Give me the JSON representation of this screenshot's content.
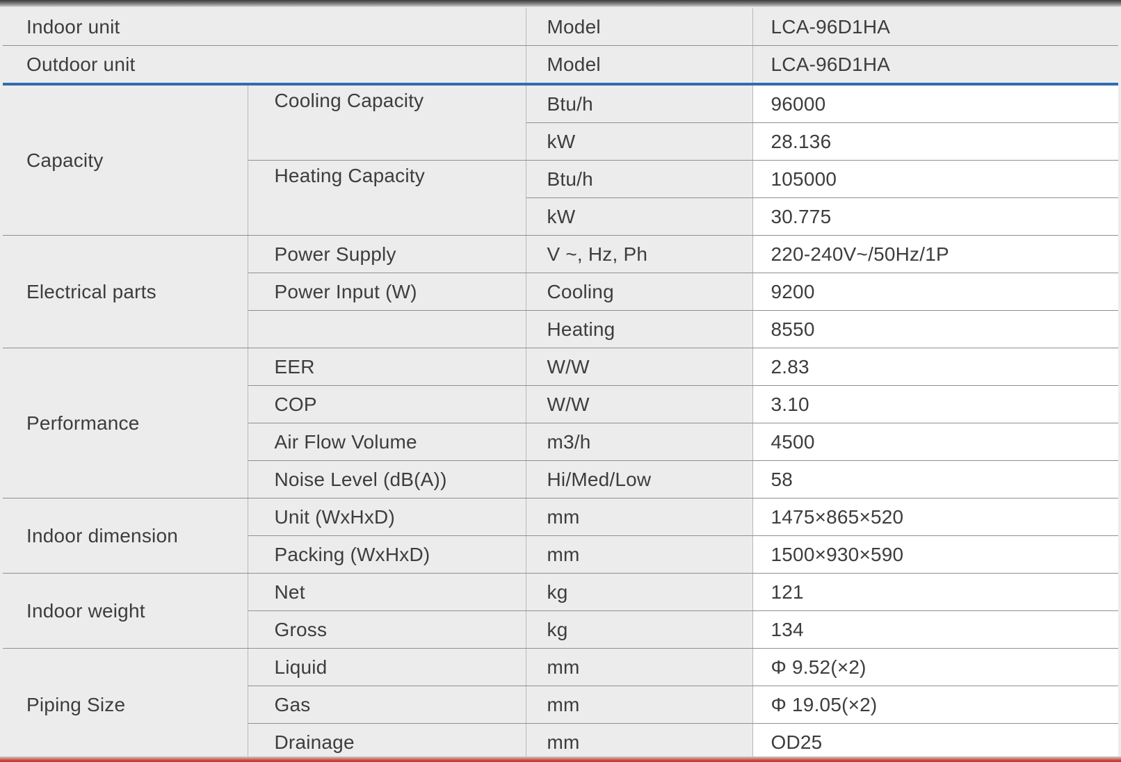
{
  "header": [
    {
      "label": "Indoor unit",
      "field": "Model",
      "value": "LCA-96D1HA"
    },
    {
      "label": "Outdoor unit",
      "field": "Model",
      "value": "LCA-96D1HA"
    }
  ],
  "sections": [
    {
      "name": "Capacity",
      "rows": [
        {
          "item": "Cooling Capacity",
          "unit": "Btu/h",
          "value": "96000"
        },
        {
          "item": "",
          "unit": "kW",
          "value": "28.136"
        },
        {
          "item": "Heating Capacity",
          "unit": "Btu/h",
          "value": "105000"
        },
        {
          "item": "",
          "unit": "kW",
          "value": "30.775"
        }
      ]
    },
    {
      "name": "Electrical   parts",
      "rows": [
        {
          "item": "Power Supply",
          "unit": "V ~, Hz, Ph",
          "value": "220-240V~/50Hz/1P"
        },
        {
          "item": "Power Input (W)",
          "unit": "Cooling",
          "value": "9200"
        },
        {
          "item": "",
          "unit": "Heating",
          "value": "8550"
        }
      ]
    },
    {
      "name": "Performance",
      "rows": [
        {
          "item": "EER",
          "unit": "W/W",
          "value": "2.83"
        },
        {
          "item": "COP",
          "unit": "W/W",
          "value": "3.10"
        },
        {
          "item": "Air Flow Volume",
          "unit": "m3/h",
          "value": "4500"
        },
        {
          "item": "Noise Level (dB(A))",
          "unit": "Hi/Med/Low",
          "value": "58"
        }
      ]
    },
    {
      "name": "Indoor dimension",
      "rows": [
        {
          "item": "Unit (WxHxD)",
          "unit": "mm",
          "value": "1475×865×520"
        },
        {
          "item": "Packing (WxHxD)",
          "unit": "mm",
          "value": "1500×930×590"
        }
      ]
    },
    {
      "name": "Indoor weight",
      "rows": [
        {
          "item": "Net",
          "unit": "kg",
          "value": "121"
        },
        {
          "item": "Gross",
          "unit": "kg",
          "value": "134"
        }
      ]
    },
    {
      "name": "Piping Size",
      "rows": [
        {
          "item": "Liquid",
          "unit": "mm",
          "value": "Φ 9.52(×2)"
        },
        {
          "item": "Gas",
          "unit": "mm",
          "value": "Φ 19.05(×2)"
        },
        {
          "item": "Drainage",
          "unit": "mm",
          "value": "OD25"
        }
      ]
    }
  ],
  "colors": {
    "header_rule": "#2f6db0",
    "grey_bg": "#ececec",
    "value_bg": "#ffffff",
    "text": "#3d3d3d"
  }
}
